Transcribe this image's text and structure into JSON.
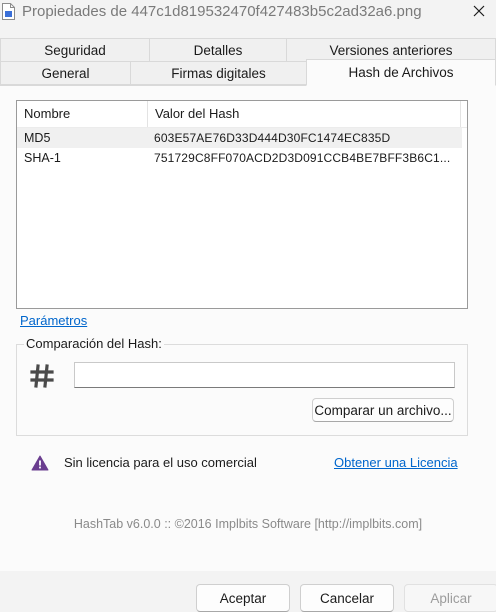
{
  "window": {
    "title": "Propiedades de 447c1d819532470f427483b5c2ad32a6.png",
    "close_glyph": "✕"
  },
  "tabs": {
    "row1": [
      {
        "label": "Seguridad"
      },
      {
        "label": "Detalles"
      },
      {
        "label": "Versiones anteriores"
      }
    ],
    "row2": [
      {
        "label": "General"
      },
      {
        "label": "Firmas digitales"
      },
      {
        "label": "Hash de Archivos",
        "active": true
      }
    ]
  },
  "hash_table": {
    "columns": [
      "Nombre",
      "Valor del Hash"
    ],
    "rows": [
      {
        "name": "MD5",
        "value": "603E57AE76D33D444D30FC1474EC835D"
      },
      {
        "name": "SHA-1",
        "value": "751729C8FF070ACD2D3D091CCB4BE7BFF3B6C1..."
      }
    ]
  },
  "params_link": "Parámetros",
  "comparison": {
    "title": "Comparación del Hash:",
    "input_value": "",
    "compare_button": "Comparar un archivo..."
  },
  "license": {
    "text": "Sin licencia para el uso comercial",
    "link": "Obtener una Licencia"
  },
  "footer": "HashTab v6.0.0 :: ©2016 Implbits Software [http://implbits.com]",
  "buttons": {
    "accept": "Aceptar",
    "cancel": "Cancelar",
    "apply": "Aplicar"
  },
  "icons": {
    "file": "file-icon",
    "close": "close-icon",
    "hash": "hash-icon",
    "warning": "warning-icon"
  },
  "colors": {
    "link": "#0066cc",
    "warning": "#6a3d8f",
    "accent_icon": "#3a6fd8"
  }
}
